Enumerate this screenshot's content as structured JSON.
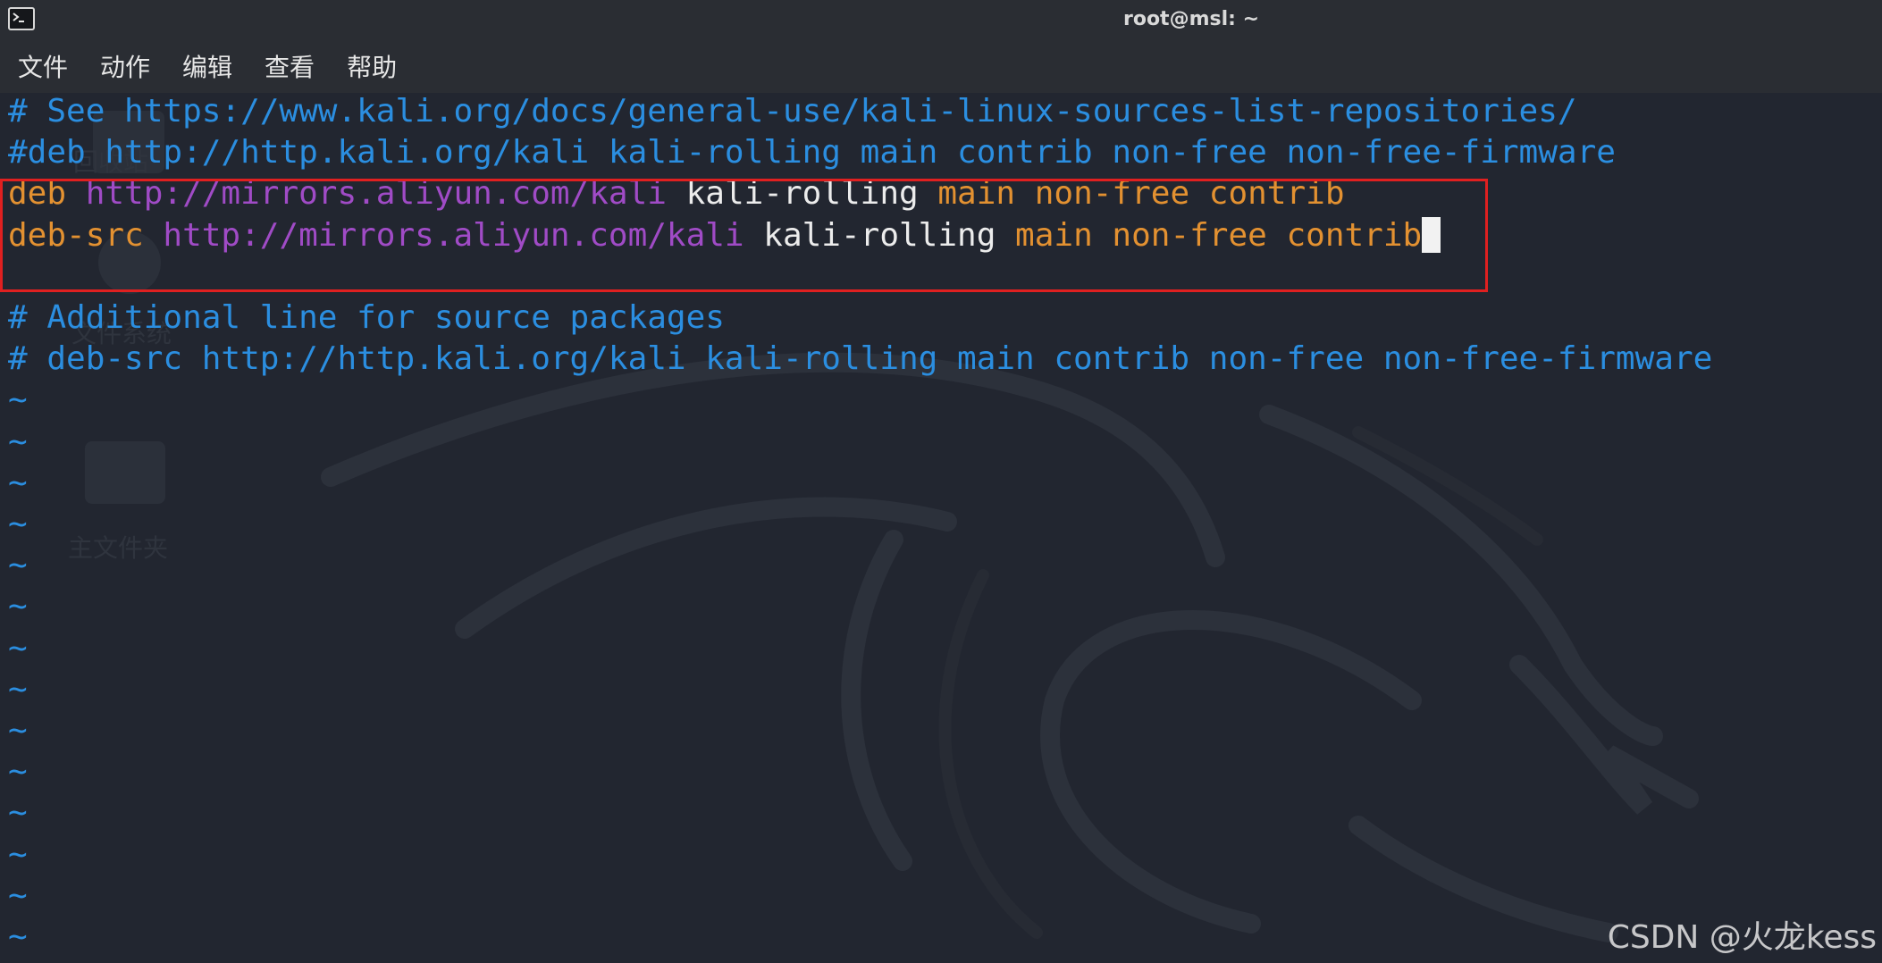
{
  "window": {
    "title": "root@msl: ~",
    "icon": "terminal-icon"
  },
  "menu": {
    "items": [
      "文件",
      "动作",
      "编辑",
      "查看",
      "帮助"
    ]
  },
  "editor": {
    "lines": [
      {
        "segments": [
          {
            "text": "# See https://www.kali.org/docs/general-use/kali-linux-sources-list-repositories/",
            "color": "comment"
          }
        ]
      },
      {
        "segments": [
          {
            "text": "#deb http://http.kali.org/kali kali-rolling main contrib non-free non-free-firmware",
            "color": "comment"
          }
        ]
      },
      {
        "segments": [
          {
            "text": "deb ",
            "color": "orange"
          },
          {
            "text": "http://mirrors.aliyun.com/kali",
            "color": "purple"
          },
          {
            "text": " kali-rolling ",
            "color": "white"
          },
          {
            "text": "main non-free contrib",
            "color": "orange"
          }
        ]
      },
      {
        "segments": [
          {
            "text": "deb-src ",
            "color": "orange"
          },
          {
            "text": "http://mirrors.aliyun.com/kali",
            "color": "purple"
          },
          {
            "text": " kali-rolling ",
            "color": "white"
          },
          {
            "text": "main non-free contrib",
            "color": "orange"
          }
        ],
        "cursor": true
      },
      {
        "segments": [
          {
            "text": "",
            "color": "white"
          }
        ]
      },
      {
        "segments": [
          {
            "text": "# Additional line for source packages",
            "color": "comment"
          }
        ]
      },
      {
        "segments": [
          {
            "text": "# deb-src http://http.kali.org/kali kali-rolling main contrib non-free non-free-firmware",
            "color": "comment"
          }
        ]
      },
      {
        "segments": [
          {
            "text": "~",
            "color": "tilde"
          }
        ]
      },
      {
        "segments": [
          {
            "text": "~",
            "color": "tilde"
          }
        ]
      },
      {
        "segments": [
          {
            "text": "~",
            "color": "tilde"
          }
        ]
      },
      {
        "segments": [
          {
            "text": "~",
            "color": "tilde"
          }
        ]
      },
      {
        "segments": [
          {
            "text": "~",
            "color": "tilde"
          }
        ]
      },
      {
        "segments": [
          {
            "text": "~",
            "color": "tilde"
          }
        ]
      },
      {
        "segments": [
          {
            "text": "~",
            "color": "tilde"
          }
        ]
      },
      {
        "segments": [
          {
            "text": "~",
            "color": "tilde"
          }
        ]
      },
      {
        "segments": [
          {
            "text": "~",
            "color": "tilde"
          }
        ]
      },
      {
        "segments": [
          {
            "text": "~",
            "color": "tilde"
          }
        ]
      },
      {
        "segments": [
          {
            "text": "~",
            "color": "tilde"
          }
        ]
      },
      {
        "segments": [
          {
            "text": "~",
            "color": "tilde"
          }
        ]
      },
      {
        "segments": [
          {
            "text": "~",
            "color": "tilde"
          }
        ]
      },
      {
        "segments": [
          {
            "text": "~",
            "color": "tilde"
          }
        ]
      }
    ],
    "highlight_color": "#e02020"
  },
  "colors": {
    "comment": "#2b8ee0",
    "orange": "#e39131",
    "purple": "#a04bc6",
    "white": "#ececec",
    "tilde": "#2b8ee0",
    "background": "#222630"
  },
  "desktop_ghost": {
    "home_folder_label": "主文件夹",
    "top_ghost_label": "回收站",
    "ghost_label_2": "文件系统"
  },
  "watermark": {
    "text": "CSDN @火龙kess"
  }
}
